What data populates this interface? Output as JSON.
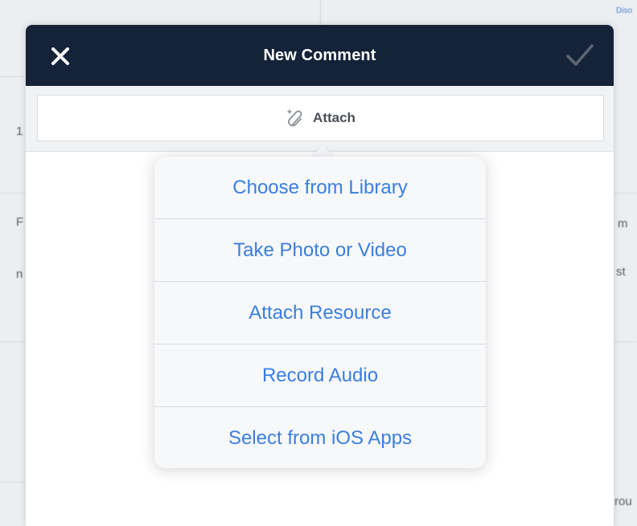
{
  "background": {
    "fragments": [
      "1",
      "F",
      "n",
      "m",
      "st",
      "rou",
      "Diso"
    ]
  },
  "modal": {
    "title": "New Comment",
    "close_icon": "close-icon",
    "done_icon": "checkmark-icon",
    "attach": {
      "label": "Attach",
      "icon": "paperclip-icon"
    }
  },
  "popover": {
    "items": [
      {
        "label": "Choose from Library"
      },
      {
        "label": "Take Photo or Video"
      },
      {
        "label": "Attach Resource"
      },
      {
        "label": "Record Audio"
      },
      {
        "label": "Select from iOS Apps"
      }
    ]
  },
  "colors": {
    "navbar": "#142338",
    "accent": "#3a7ee0",
    "attach_text": "#4b4f56"
  }
}
